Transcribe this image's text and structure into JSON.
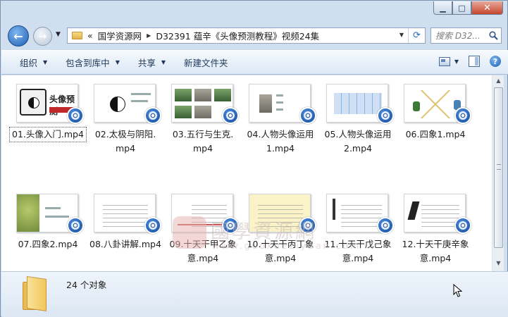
{
  "window": {
    "caption_buttons": {
      "minimize": "▁",
      "maximize": "□",
      "close": "✕"
    }
  },
  "nav": {
    "address_prefix": "«",
    "breadcrumb": [
      "国学资源网",
      "D32391 蕴辛《头像预测教程》视频24集"
    ],
    "search_placeholder": "搜索 D32..."
  },
  "commands": [
    {
      "label": "组织"
    },
    {
      "label": "包含到库中"
    },
    {
      "label": "共享"
    },
    {
      "label": "新建文件夹"
    }
  ],
  "files": [
    {
      "line1": "01.头像入门.mp4",
      "line2": "",
      "selected": true
    },
    {
      "line1": "02.太极与阴阳.",
      "line2": "mp4"
    },
    {
      "line1": "03.五行与生克.",
      "line2": "mp4"
    },
    {
      "line1": "04.人物头像运用",
      "line2": "1.mp4"
    },
    {
      "line1": "05.人物头像运用",
      "line2": "2.mp4"
    },
    {
      "line1": "06.四象1.mp4",
      "line2": ""
    },
    {
      "line1": "07.四象2.mp4",
      "line2": ""
    },
    {
      "line1": "08.八卦讲解.mp4",
      "line2": ""
    },
    {
      "line1": "09.十天干甲乙象",
      "line2": "意.mp4"
    },
    {
      "line1": "10.十天干丙丁象",
      "line2": "意.mp4"
    },
    {
      "line1": "11.十天干戊己象",
      "line2": "意.mp4"
    },
    {
      "line1": "12.十天干庚辛象",
      "line2": "意.mp4"
    }
  ],
  "thumb_text": {
    "t1_title": "头像预测"
  },
  "watermark": {
    "seal": "国",
    "big": "國學資源網",
    "url": "www.guoxueziyuan.com"
  },
  "status": {
    "count": "24 个对象"
  },
  "colors": {
    "accent_blue": "#1f5fb3",
    "cmd_text": "#1e395b",
    "window_frame": "#cfdff0"
  }
}
